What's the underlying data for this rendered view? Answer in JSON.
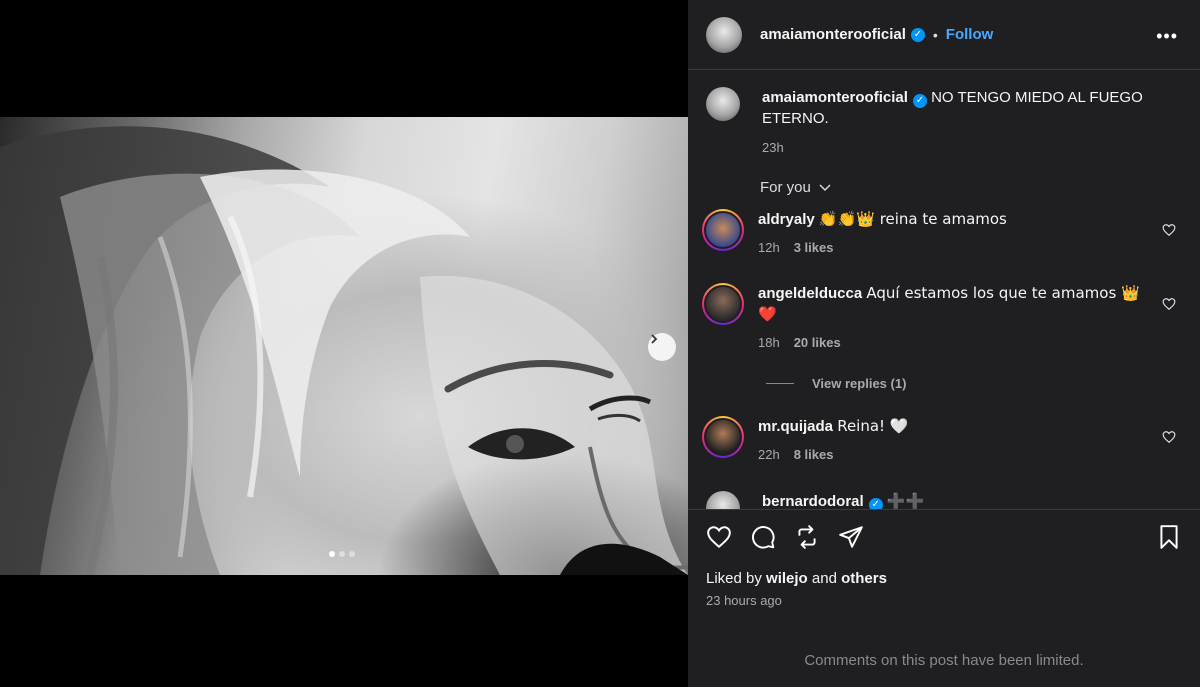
{
  "post": {
    "username": "amaiamonterooficial",
    "separator": "•",
    "follow_label": "Follow",
    "more_label": "•••",
    "caption": "NO TENGO MIEDO AL FUEGO ETERNO.",
    "caption_time": "23h",
    "carousel": {
      "slides": 3,
      "active": 0
    }
  },
  "comments_filter": "For you",
  "comments": [
    {
      "username": "aldryaly",
      "text": "👏👏👑 reina te amamos",
      "time": "12h",
      "likes": "3 likes"
    },
    {
      "username": "angeldelducca",
      "text": "Aquí estamos los que te amamos 👑 ❤️",
      "time": "18h",
      "likes": "20 likes"
    },
    {
      "username": "mr.quijada",
      "text": "Reina! 🤍",
      "time": "22h",
      "likes": "8 likes"
    },
    {
      "username": "bernardodoral",
      "text": "➕➕"
    }
  ],
  "view_replies": "View replies (1)",
  "footer": {
    "liked_prefix": "Liked by ",
    "liked_user": "wilejo",
    "liked_mid": " and ",
    "liked_others": "others",
    "time_ago": "23 hours ago",
    "limited_notice": "Comments on this post have been limited."
  },
  "colors": {
    "panel_bg": "#1f1f22",
    "accent": "#4aa8ff",
    "verified": "#0095f6"
  }
}
